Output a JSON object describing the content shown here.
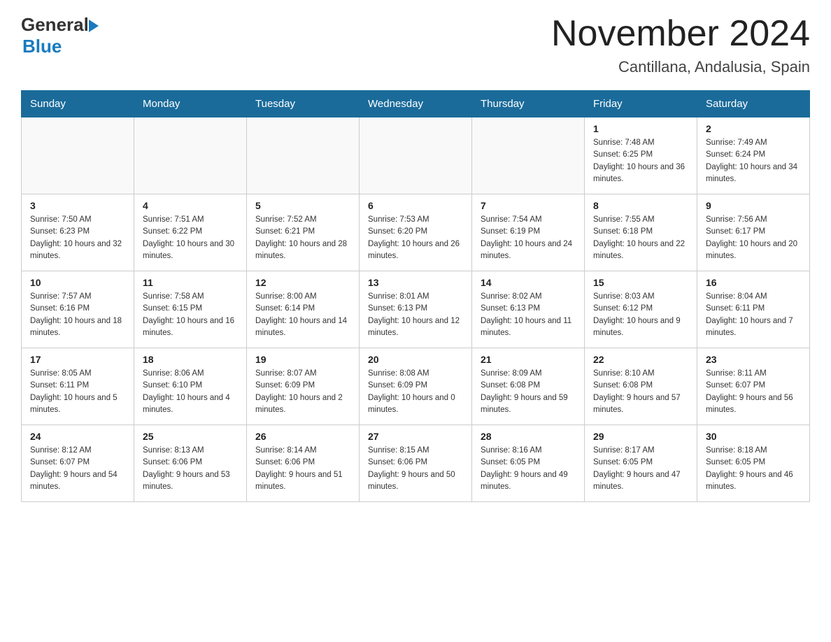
{
  "logo": {
    "text_general": "General",
    "text_blue": "Blue"
  },
  "header": {
    "month_year": "November 2024",
    "location": "Cantillana, Andalusia, Spain"
  },
  "days_of_week": [
    "Sunday",
    "Monday",
    "Tuesday",
    "Wednesday",
    "Thursday",
    "Friday",
    "Saturday"
  ],
  "weeks": [
    [
      {
        "day": "",
        "info": ""
      },
      {
        "day": "",
        "info": ""
      },
      {
        "day": "",
        "info": ""
      },
      {
        "day": "",
        "info": ""
      },
      {
        "day": "",
        "info": ""
      },
      {
        "day": "1",
        "info": "Sunrise: 7:48 AM\nSunset: 6:25 PM\nDaylight: 10 hours and 36 minutes."
      },
      {
        "day": "2",
        "info": "Sunrise: 7:49 AM\nSunset: 6:24 PM\nDaylight: 10 hours and 34 minutes."
      }
    ],
    [
      {
        "day": "3",
        "info": "Sunrise: 7:50 AM\nSunset: 6:23 PM\nDaylight: 10 hours and 32 minutes."
      },
      {
        "day": "4",
        "info": "Sunrise: 7:51 AM\nSunset: 6:22 PM\nDaylight: 10 hours and 30 minutes."
      },
      {
        "day": "5",
        "info": "Sunrise: 7:52 AM\nSunset: 6:21 PM\nDaylight: 10 hours and 28 minutes."
      },
      {
        "day": "6",
        "info": "Sunrise: 7:53 AM\nSunset: 6:20 PM\nDaylight: 10 hours and 26 minutes."
      },
      {
        "day": "7",
        "info": "Sunrise: 7:54 AM\nSunset: 6:19 PM\nDaylight: 10 hours and 24 minutes."
      },
      {
        "day": "8",
        "info": "Sunrise: 7:55 AM\nSunset: 6:18 PM\nDaylight: 10 hours and 22 minutes."
      },
      {
        "day": "9",
        "info": "Sunrise: 7:56 AM\nSunset: 6:17 PM\nDaylight: 10 hours and 20 minutes."
      }
    ],
    [
      {
        "day": "10",
        "info": "Sunrise: 7:57 AM\nSunset: 6:16 PM\nDaylight: 10 hours and 18 minutes."
      },
      {
        "day": "11",
        "info": "Sunrise: 7:58 AM\nSunset: 6:15 PM\nDaylight: 10 hours and 16 minutes."
      },
      {
        "day": "12",
        "info": "Sunrise: 8:00 AM\nSunset: 6:14 PM\nDaylight: 10 hours and 14 minutes."
      },
      {
        "day": "13",
        "info": "Sunrise: 8:01 AM\nSunset: 6:13 PM\nDaylight: 10 hours and 12 minutes."
      },
      {
        "day": "14",
        "info": "Sunrise: 8:02 AM\nSunset: 6:13 PM\nDaylight: 10 hours and 11 minutes."
      },
      {
        "day": "15",
        "info": "Sunrise: 8:03 AM\nSunset: 6:12 PM\nDaylight: 10 hours and 9 minutes."
      },
      {
        "day": "16",
        "info": "Sunrise: 8:04 AM\nSunset: 6:11 PM\nDaylight: 10 hours and 7 minutes."
      }
    ],
    [
      {
        "day": "17",
        "info": "Sunrise: 8:05 AM\nSunset: 6:11 PM\nDaylight: 10 hours and 5 minutes."
      },
      {
        "day": "18",
        "info": "Sunrise: 8:06 AM\nSunset: 6:10 PM\nDaylight: 10 hours and 4 minutes."
      },
      {
        "day": "19",
        "info": "Sunrise: 8:07 AM\nSunset: 6:09 PM\nDaylight: 10 hours and 2 minutes."
      },
      {
        "day": "20",
        "info": "Sunrise: 8:08 AM\nSunset: 6:09 PM\nDaylight: 10 hours and 0 minutes."
      },
      {
        "day": "21",
        "info": "Sunrise: 8:09 AM\nSunset: 6:08 PM\nDaylight: 9 hours and 59 minutes."
      },
      {
        "day": "22",
        "info": "Sunrise: 8:10 AM\nSunset: 6:08 PM\nDaylight: 9 hours and 57 minutes."
      },
      {
        "day": "23",
        "info": "Sunrise: 8:11 AM\nSunset: 6:07 PM\nDaylight: 9 hours and 56 minutes."
      }
    ],
    [
      {
        "day": "24",
        "info": "Sunrise: 8:12 AM\nSunset: 6:07 PM\nDaylight: 9 hours and 54 minutes."
      },
      {
        "day": "25",
        "info": "Sunrise: 8:13 AM\nSunset: 6:06 PM\nDaylight: 9 hours and 53 minutes."
      },
      {
        "day": "26",
        "info": "Sunrise: 8:14 AM\nSunset: 6:06 PM\nDaylight: 9 hours and 51 minutes."
      },
      {
        "day": "27",
        "info": "Sunrise: 8:15 AM\nSunset: 6:06 PM\nDaylight: 9 hours and 50 minutes."
      },
      {
        "day": "28",
        "info": "Sunrise: 8:16 AM\nSunset: 6:05 PM\nDaylight: 9 hours and 49 minutes."
      },
      {
        "day": "29",
        "info": "Sunrise: 8:17 AM\nSunset: 6:05 PM\nDaylight: 9 hours and 47 minutes."
      },
      {
        "day": "30",
        "info": "Sunrise: 8:18 AM\nSunset: 6:05 PM\nDaylight: 9 hours and 46 minutes."
      }
    ]
  ]
}
